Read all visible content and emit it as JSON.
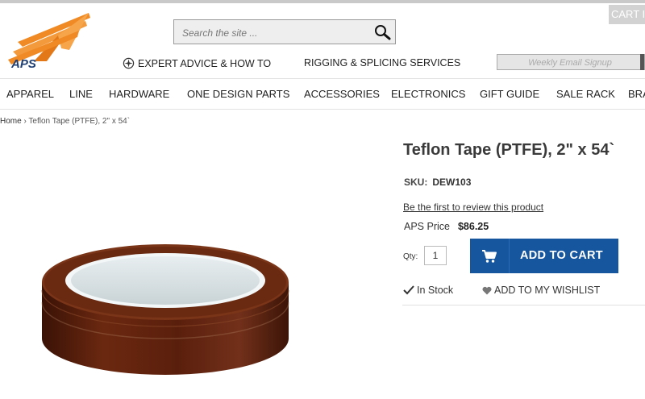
{
  "header": {
    "logo_text": "APS",
    "cart_label": "CART IS",
    "search": {
      "placeholder": "Search the site ..."
    },
    "util_links": {
      "expert": "EXPERT ADVICE & HOW TO",
      "rigging": "RIGGING & SPLICING SERVICES"
    },
    "email_signup": {
      "placeholder": "Weekly Email Signup"
    }
  },
  "nav": {
    "items": [
      "APPAREL",
      "LINE",
      "HARDWARE",
      "ONE DESIGN PARTS",
      "ACCESSORIES",
      "ELECTRONICS",
      "GIFT GUIDE",
      "SALE RACK",
      "BRA"
    ]
  },
  "breadcrumb": {
    "home": "Home",
    "separator": " › ",
    "current": "Teflon Tape (PTFE), 2\" x 54`"
  },
  "product": {
    "title": "Teflon Tape (PTFE), 2\" x 54`",
    "sku_label": "SKU:",
    "sku": "DEW103",
    "review_link": "Be the first to review this product",
    "price_label": "APS Price",
    "price": "$86.25",
    "qty_label": "Qty:",
    "qty_value": "1",
    "add_to_cart": "ADD TO CART",
    "stock": "In Stock",
    "wishlist": "ADD TO MY WISHLIST"
  },
  "colors": {
    "brand_orange": "#f08a24",
    "button_blue": "#16569f",
    "tape_brown": "#5a1f0c"
  }
}
